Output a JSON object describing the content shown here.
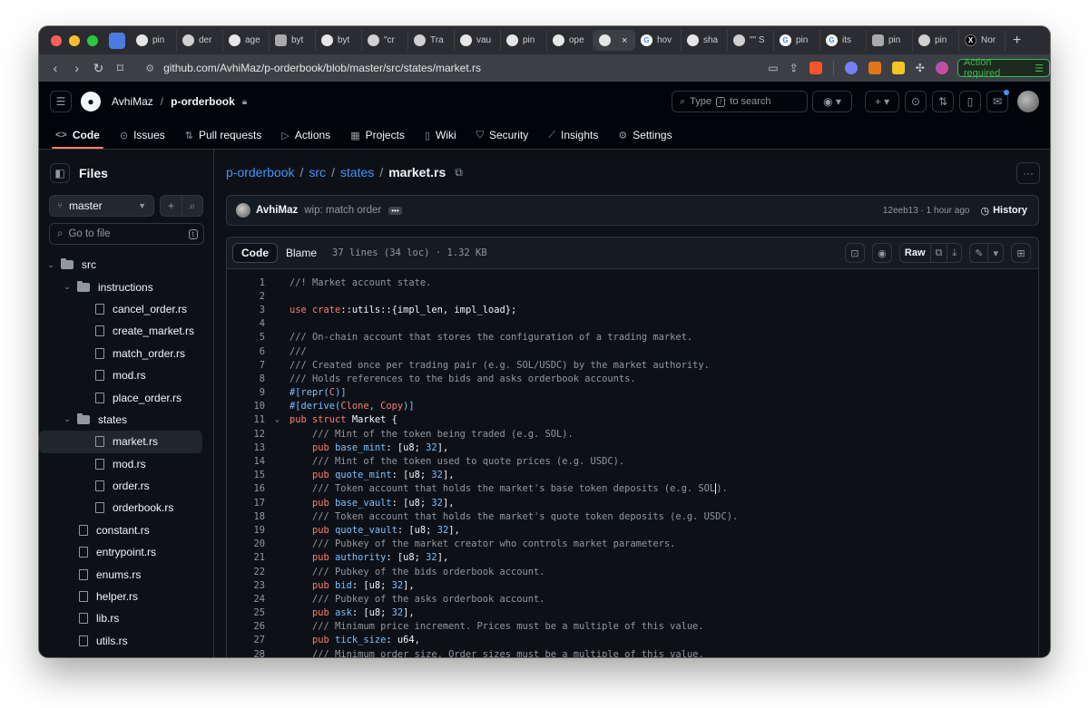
{
  "browser": {
    "tabs": [
      {
        "icon": "github-icon",
        "label": "pin",
        "kind": "gh"
      },
      {
        "icon": "copilot-icon",
        "label": "der",
        "kind": "cp"
      },
      {
        "icon": "github-icon",
        "label": "age",
        "kind": "gh"
      },
      {
        "icon": "bot-icon",
        "label": "byt",
        "kind": "bot"
      },
      {
        "icon": "github-icon",
        "label": "byt",
        "kind": "gh"
      },
      {
        "icon": "copilot-icon",
        "label": "\"cr",
        "kind": "cp"
      },
      {
        "icon": "copilot-icon",
        "label": "Tra",
        "kind": "cp"
      },
      {
        "icon": "github-icon",
        "label": "vau",
        "kind": "gh"
      },
      {
        "icon": "github-icon",
        "label": "pin",
        "kind": "gh"
      },
      {
        "icon": "github-icon",
        "label": "ope",
        "kind": "gh"
      },
      {
        "icon": "github-icon",
        "label": "",
        "kind": "gh",
        "active": true
      },
      {
        "icon": "google-icon",
        "label": "hov",
        "kind": "g"
      },
      {
        "icon": "github-icon",
        "label": "sha",
        "kind": "gh"
      },
      {
        "icon": "copilot-icon",
        "label": "\"\" S",
        "kind": "cp"
      },
      {
        "icon": "google-icon",
        "label": "pin",
        "kind": "g"
      },
      {
        "icon": "google-icon",
        "label": "its",
        "kind": "g"
      },
      {
        "icon": "zig-icon",
        "label": "pin",
        "kind": "bot"
      },
      {
        "icon": "copilot-icon",
        "label": "pin",
        "kind": "cp"
      },
      {
        "icon": "x-icon",
        "label": "Nor",
        "kind": "x"
      }
    ],
    "url": "github.com/AvhiMaz/p-orderbook/blob/master/src/states/market.rs",
    "action_required": "Action required"
  },
  "header": {
    "owner": "AvhiMaz",
    "repo": "p-orderbook",
    "search_placeholder_pre": "Type",
    "search_key": "/",
    "search_placeholder_post": "to search",
    "nav": [
      {
        "label": "Code",
        "icon": "code-icon",
        "active": true
      },
      {
        "label": "Issues",
        "icon": "issue-icon"
      },
      {
        "label": "Pull requests",
        "icon": "pull-request-icon"
      },
      {
        "label": "Actions",
        "icon": "play-icon"
      },
      {
        "label": "Projects",
        "icon": "table-icon"
      },
      {
        "label": "Wiki",
        "icon": "book-icon"
      },
      {
        "label": "Security",
        "icon": "shield-icon"
      },
      {
        "label": "Insights",
        "icon": "graph-icon"
      },
      {
        "label": "Settings",
        "icon": "gear-icon"
      }
    ]
  },
  "sidebar": {
    "title": "Files",
    "branch": "master",
    "goto_placeholder": "Go to file",
    "goto_key": "t",
    "tree": [
      {
        "label": "src",
        "type": "folder",
        "depth": 0,
        "open": true
      },
      {
        "label": "instructions",
        "type": "folder",
        "depth": 1,
        "open": true
      },
      {
        "label": "cancel_order.rs",
        "type": "file",
        "depth": 2
      },
      {
        "label": "create_market.rs",
        "type": "file",
        "depth": 2
      },
      {
        "label": "match_order.rs",
        "type": "file",
        "depth": 2
      },
      {
        "label": "mod.rs",
        "type": "file",
        "depth": 2
      },
      {
        "label": "place_order.rs",
        "type": "file",
        "depth": 2
      },
      {
        "label": "states",
        "type": "folder",
        "depth": 1,
        "open": true
      },
      {
        "label": "market.rs",
        "type": "file",
        "depth": 2,
        "selected": true
      },
      {
        "label": "mod.rs",
        "type": "file",
        "depth": 2
      },
      {
        "label": "order.rs",
        "type": "file",
        "depth": 2
      },
      {
        "label": "orderbook.rs",
        "type": "file",
        "depth": 2
      },
      {
        "label": "constant.rs",
        "type": "file",
        "depth": 1
      },
      {
        "label": "entrypoint.rs",
        "type": "file",
        "depth": 1
      },
      {
        "label": "enums.rs",
        "type": "file",
        "depth": 1
      },
      {
        "label": "helper.rs",
        "type": "file",
        "depth": 1
      },
      {
        "label": "lib.rs",
        "type": "file",
        "depth": 1
      },
      {
        "label": "utils.rs",
        "type": "file",
        "depth": 1
      }
    ]
  },
  "main": {
    "breadcrumb": [
      "p-orderbook",
      "src",
      "states"
    ],
    "filename": "market.rs",
    "commit": {
      "author": "AvhiMaz",
      "message": "wip: match order",
      "meta": "12eeb13 · 1 hour ago",
      "history": "History"
    },
    "tabs": {
      "code": "Code",
      "blame": "Blame"
    },
    "file_info": "37 lines (34 loc) · 1.32 KB",
    "raw": "Raw",
    "lines": [
      [
        [
          "c",
          "//! Market account state."
        ]
      ],
      [],
      [
        [
          "k",
          "use "
        ],
        [
          "k",
          "crate"
        ],
        [
          "t",
          "::utils::{impl_len, impl_load};"
        ]
      ],
      [],
      [
        [
          "c",
          "/// On-chain account that stores the configuration of a trading market."
        ]
      ],
      [
        [
          "c",
          "///"
        ]
      ],
      [
        [
          "c",
          "/// Created once per trading pair (e.g. SOL/USDC) by the market authority."
        ]
      ],
      [
        [
          "c",
          "/// Holds references to the bids and asks orderbook accounts."
        ]
      ],
      [
        [
          "n",
          "#[repr("
        ],
        [
          "k",
          "C"
        ],
        [
          "n",
          ")]"
        ]
      ],
      [
        [
          "n",
          "#[derive("
        ],
        [
          "k",
          "Clone"
        ],
        [
          "n",
          ", "
        ],
        [
          "k",
          "Copy"
        ],
        [
          "n",
          ")]"
        ]
      ],
      [
        [
          "k",
          "pub struct "
        ],
        [
          "t",
          "Market {"
        ]
      ],
      [
        [
          "t",
          "    "
        ],
        [
          "c",
          "/// Mint of the token being traded (e.g. SOL)."
        ]
      ],
      [
        [
          "t",
          "    "
        ],
        [
          "k",
          "pub "
        ],
        [
          "n",
          "base_mint"
        ],
        [
          "t",
          ": [u8; "
        ],
        [
          "n",
          "32"
        ],
        [
          "t",
          "],"
        ]
      ],
      [
        [
          "t",
          "    "
        ],
        [
          "c",
          "/// Mint of the token used to quote prices (e.g. USDC)."
        ]
      ],
      [
        [
          "t",
          "    "
        ],
        [
          "k",
          "pub "
        ],
        [
          "n",
          "quote_mint"
        ],
        [
          "t",
          ": [u8; "
        ],
        [
          "n",
          "32"
        ],
        [
          "t",
          "],"
        ]
      ],
      [
        [
          "t",
          "    "
        ],
        [
          "c",
          "/// Token account that holds the market's base token deposits (e.g. SOL"
        ],
        [
          "cur",
          ""
        ],
        [
          "c",
          ")."
        ]
      ],
      [
        [
          "t",
          "    "
        ],
        [
          "k",
          "pub "
        ],
        [
          "n",
          "base_vault"
        ],
        [
          "t",
          ": [u8; "
        ],
        [
          "n",
          "32"
        ],
        [
          "t",
          "],"
        ]
      ],
      [
        [
          "t",
          "    "
        ],
        [
          "c",
          "/// Token account that holds the market's quote token deposits (e.g. USDC)."
        ]
      ],
      [
        [
          "t",
          "    "
        ],
        [
          "k",
          "pub "
        ],
        [
          "n",
          "quote_vault"
        ],
        [
          "t",
          ": [u8; "
        ],
        [
          "n",
          "32"
        ],
        [
          "t",
          "],"
        ]
      ],
      [
        [
          "t",
          "    "
        ],
        [
          "c",
          "/// Pubkey of the market creator who controls market parameters."
        ]
      ],
      [
        [
          "t",
          "    "
        ],
        [
          "k",
          "pub "
        ],
        [
          "n",
          "authority"
        ],
        [
          "t",
          ": [u8; "
        ],
        [
          "n",
          "32"
        ],
        [
          "t",
          "],"
        ]
      ],
      [
        [
          "t",
          "    "
        ],
        [
          "c",
          "/// Pubkey of the bids orderbook account."
        ]
      ],
      [
        [
          "t",
          "    "
        ],
        [
          "k",
          "pub "
        ],
        [
          "n",
          "bid"
        ],
        [
          "t",
          ": [u8; "
        ],
        [
          "n",
          "32"
        ],
        [
          "t",
          "],"
        ]
      ],
      [
        [
          "t",
          "    "
        ],
        [
          "c",
          "/// Pubkey of the asks orderbook account."
        ]
      ],
      [
        [
          "t",
          "    "
        ],
        [
          "k",
          "pub "
        ],
        [
          "n",
          "ask"
        ],
        [
          "t",
          ": [u8; "
        ],
        [
          "n",
          "32"
        ],
        [
          "t",
          "],"
        ]
      ],
      [
        [
          "t",
          "    "
        ],
        [
          "c",
          "/// Minimum price increment. Prices must be a multiple of this value."
        ]
      ],
      [
        [
          "t",
          "    "
        ],
        [
          "k",
          "pub "
        ],
        [
          "n",
          "tick_size"
        ],
        [
          "t",
          ": u64,"
        ]
      ],
      [
        [
          "t",
          "    "
        ],
        [
          "c",
          "/// Minimum order size. Order sizes must be a multiple of this value."
        ]
      ]
    ]
  }
}
